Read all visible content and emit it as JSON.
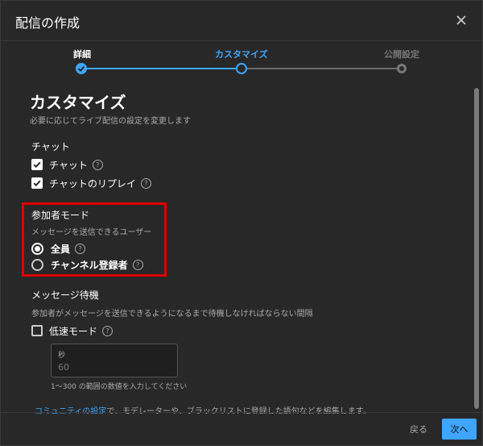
{
  "dialog": {
    "title": "配信の作成"
  },
  "stepper": {
    "steps": [
      {
        "label": "詳細",
        "state": "done"
      },
      {
        "label": "カスタマイズ",
        "state": "current"
      },
      {
        "label": "公開設定",
        "state": "pending"
      }
    ],
    "accent_color": "#3ea6ff"
  },
  "customize": {
    "title": "カスタマイズ",
    "subtitle": "必要に応じてライブ配信の設定を変更します"
  },
  "chat": {
    "heading": "チャット",
    "options": [
      {
        "label": "チャット",
        "checked": true
      },
      {
        "label": "チャットのリプレイ",
        "checked": true
      }
    ]
  },
  "participant_mode": {
    "heading": "参加者モード",
    "description": "メッセージを送信できるユーザー",
    "options": [
      {
        "label": "全員",
        "selected": true
      },
      {
        "label": "チャンネル登録者",
        "selected": false
      }
    ],
    "highlight_color": "#e00000"
  },
  "message_delay": {
    "heading": "メッセージ待機",
    "description": "参加者がメッセージを送信できるようになるまで待機しなければならない間隔",
    "slow_mode": {
      "label": "低速モード",
      "checked": false
    },
    "seconds_field": {
      "label": "秒",
      "placeholder": "60"
    },
    "hint": "1～300 の範囲の数値を入力してください"
  },
  "community_note": {
    "link": "コミュニティの設定",
    "text": "で、モデレーターや、ブラックリストに登録した語句などを編集します。"
  },
  "footer": {
    "back_label": "戻る",
    "next_label": "次へ"
  },
  "icons": {
    "help": "?",
    "close": "close-icon",
    "checkmark": "check-icon"
  }
}
